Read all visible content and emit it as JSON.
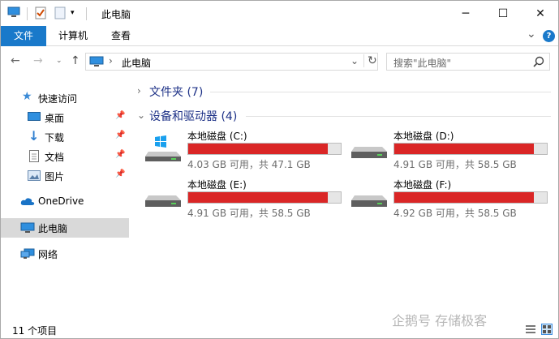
{
  "window": {
    "title": "此电脑",
    "minimize_glyph": "─",
    "maximize_glyph": "☐",
    "close_glyph": "✕"
  },
  "ribbon": {
    "tabs": [
      {
        "label": "文件",
        "active": true
      },
      {
        "label": "计算机"
      },
      {
        "label": "查看"
      }
    ],
    "expand_glyph": "⌄",
    "help_glyph": "?"
  },
  "address": {
    "path": "此电脑",
    "search_placeholder": "搜索\"此电脑\""
  },
  "nav": {
    "quick_access": "快速访问",
    "quick_items": [
      {
        "label": "桌面",
        "icon": "desktop-icon"
      },
      {
        "label": "下载",
        "icon": "download-icon"
      },
      {
        "label": "文档",
        "icon": "document-icon"
      },
      {
        "label": "图片",
        "icon": "picture-icon"
      }
    ],
    "onedrive": "OneDrive",
    "this_pc": "此电脑",
    "network": "网络"
  },
  "content": {
    "folders_header": "文件夹 (7)",
    "devices_header": "设备和驱动器 (4)",
    "drives": [
      {
        "name": "本地磁盘 (C:)",
        "info": "4.03 GB 可用，共 47.1 GB",
        "used_fraction": 0.914,
        "system": true
      },
      {
        "name": "本地磁盘 (D:)",
        "info": "4.91 GB 可用，共 58.5 GB",
        "used_fraction": 0.916,
        "system": false
      },
      {
        "name": "本地磁盘 (E:)",
        "info": "4.91 GB 可用，共 58.5 GB",
        "used_fraction": 0.916,
        "system": false
      },
      {
        "name": "本地磁盘 (F:)",
        "info": "4.92 GB 可用，共 58.5 GB",
        "used_fraction": 0.916,
        "system": false
      }
    ]
  },
  "status": {
    "item_count": "11 个项目",
    "watermark": "企鹅号 存储极客"
  },
  "colors": {
    "accent": "#1979ca",
    "drive_full": "#da2626",
    "selected_nav": "#d9d9d9"
  }
}
